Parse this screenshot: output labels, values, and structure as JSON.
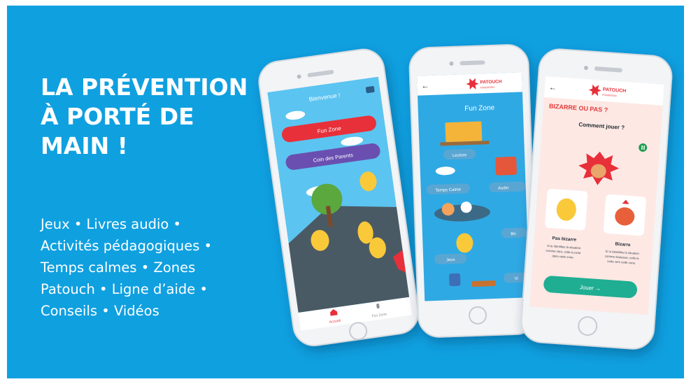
{
  "headline": [
    "LA PRÉVENTION",
    "À PORTÉ DE",
    "MAIN !"
  ],
  "features": [
    "Jeux  •  Livres audio  •",
    "Activités pédagogiques •",
    "Temps calmes  •  Zones",
    "Patouch  •  Ligne d’aide  •",
    "Conseils • Vidéos"
  ],
  "phone_left": {
    "icon": "user-icon",
    "greeting": "Bienvenue !",
    "fun_zone_button": "Fun Zone",
    "parents_button": "Coin des Parents",
    "nav_home_label": "Accueil",
    "nav_home_icon": "home-icon",
    "nav_funzone_label": "Fun Zone",
    "nav_funzone_icon": "mic-icon",
    "colors": {
      "fun_zone": "#e8303a",
      "parents": "#6a4fb0",
      "sky": "#5cc4f0"
    }
  },
  "phone_middle": {
    "back_icon": "back-arrow-icon",
    "brand": "PATOUCH",
    "brand_sub": "FONDATION",
    "heading": "Fun Zone",
    "labels": [
      "Lecture",
      "Temps Calme",
      "Audio",
      "Bri",
      "Jeux",
      "Vi"
    ]
  },
  "phone_right": {
    "back_icon": "back-arrow-icon",
    "brand": "PATOUCH",
    "brand_sub": "FONDATION",
    "title": "BIZARRE OU PAS ?",
    "how_to": "Comment jouer ?",
    "pause_icon": "pause-icon",
    "card_left_title": "Pas bizarre",
    "card_left_text": [
      "Si tu identifies la situation",
      "comme sûre, colle la carte",
      "dans cette zone."
    ],
    "card_right_title": "Bizarre",
    "card_right_text": [
      "Si tu identifies la situation",
      "comme douteuse, colle la",
      "carte vers cette zone."
    ],
    "play_button": "Jouer →",
    "colors": {
      "title": "#e23a3a",
      "play": "#1fae92",
      "bg": "#fde8e4"
    }
  }
}
